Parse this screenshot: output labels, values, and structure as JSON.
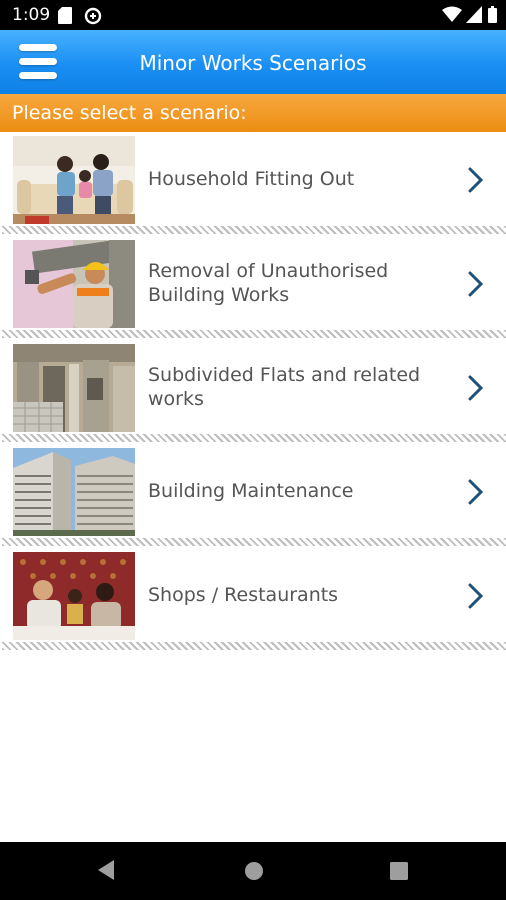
{
  "status_bar": {
    "time": "1:09",
    "icons": [
      "sd-card-icon",
      "data-saver-icon",
      "wifi-icon",
      "signal-icon",
      "battery-icon"
    ]
  },
  "app_bar": {
    "title": "Minor Works Scenarios",
    "menu_icon": "hamburger-menu-icon"
  },
  "section_header": "Please select a scenario:",
  "scenarios": [
    {
      "label_lines": [
        "Household Fitting Out"
      ],
      "thumbnail": "family-on-sofa-photo"
    },
    {
      "label_lines": [
        "Removal of Unauthorised",
        "Building Works"
      ],
      "thumbnail": "worker-with-helmet-photo"
    },
    {
      "label_lines": [
        "Subdivided Flats and related",
        "works"
      ],
      "thumbnail": "subdivided-flat-interior-photo"
    },
    {
      "label_lines": [
        "Building Maintenance"
      ],
      "thumbnail": "residential-tower-photo"
    },
    {
      "label_lines": [
        "Shops / Restaurants"
      ],
      "thumbnail": "restaurant-diners-photo"
    }
  ],
  "colors": {
    "app_bar": "#1a8ff3",
    "section_header": "#ec8d12",
    "chevron": "#1f4f7a",
    "label_text": "#555555"
  },
  "nav_bar": {
    "icons": [
      "back-icon",
      "home-icon",
      "recents-icon"
    ]
  }
}
